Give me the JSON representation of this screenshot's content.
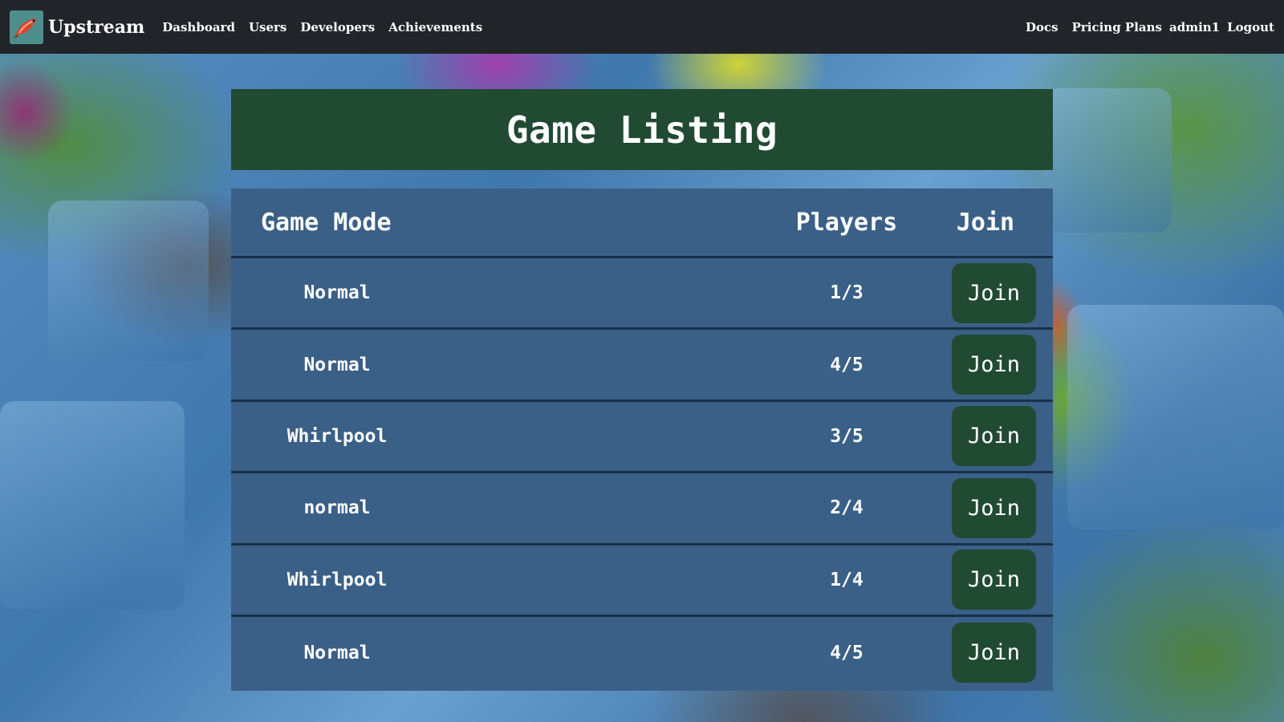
{
  "navbar": {
    "brand": "Upstream",
    "links_left": [
      "Dashboard",
      "Users",
      "Developers",
      "Achievements"
    ],
    "links_right": [
      "Docs",
      "Pricing Plans",
      "admin1",
      "Logout"
    ]
  },
  "title": "Game Listing",
  "table": {
    "headers": {
      "mode": "Game Mode",
      "players": "Players",
      "join": "Join"
    },
    "rows": [
      {
        "mode": "Normal",
        "players": "1/3",
        "join": "Join"
      },
      {
        "mode": "Normal",
        "players": "4/5",
        "join": "Join"
      },
      {
        "mode": "Whirlpool",
        "players": "3/5",
        "join": "Join"
      },
      {
        "mode": "normal",
        "players": "2/4",
        "join": "Join"
      },
      {
        "mode": "Whirlpool",
        "players": "1/4",
        "join": "Join"
      },
      {
        "mode": "Normal",
        "players": "4/5",
        "join": "Join"
      }
    ]
  },
  "colors": {
    "navbar": "#212529",
    "title_panel": "#214a33",
    "table": "#3a6087",
    "row_divider": "#183048",
    "join_button": "#214a33"
  },
  "icons": {
    "logo": "salmon-logo-icon"
  }
}
